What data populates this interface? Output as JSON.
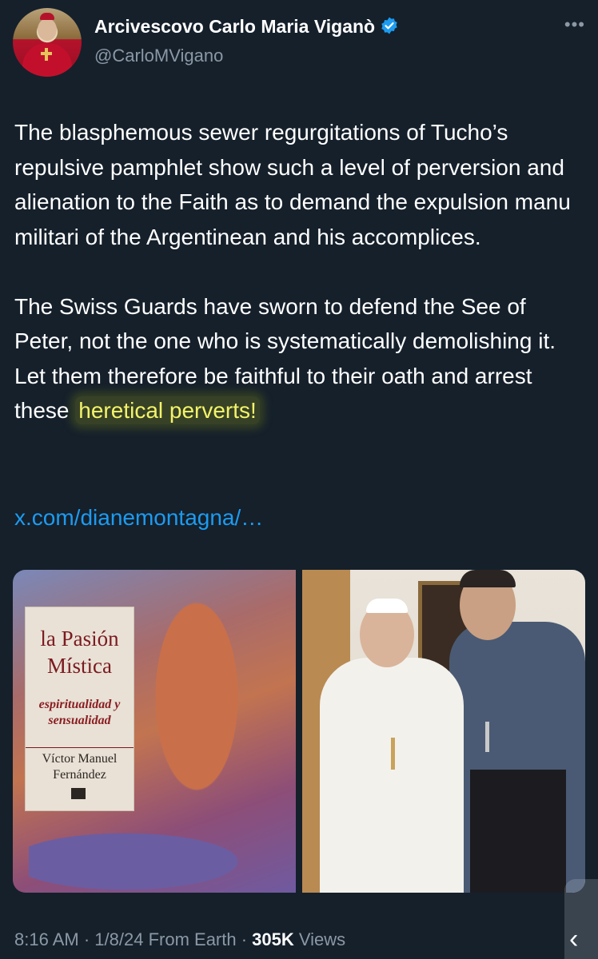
{
  "author": {
    "display_name": "Arcivescovo Carlo Maria Viganò",
    "handle": "@CarloMVigano",
    "verified": true,
    "more_icon": "more-horizontal-icon"
  },
  "tweet": {
    "paragraph1": "The blasphemous sewer regurgitations of Tucho’s repulsive pamphlet show such a level of perversion and alienation to the Faith as to demand the expulsion manu militari of the Argentinean and his accomplices.",
    "paragraph2_before": "The Swiss Guards have sworn to defend the See of Peter, not the one who is systematically demolishing it. Let them therefore be faithful to their oath and arrest these ",
    "paragraph2_highlight": "heretical perverts!",
    "link": "x.com/dianemontagna/…",
    "highlight_color": "#f3f36a",
    "link_color": "#1d9bf0"
  },
  "media": {
    "book": {
      "title": "la Pasión Mística",
      "subtitle": "espiritualidad y sensualidad",
      "author": "Víctor Manuel Fernández"
    }
  },
  "meta": {
    "time": "8:16 AM",
    "date": "1/8/24",
    "source": "From Earth",
    "views_count": "305K",
    "views_label": "Views"
  },
  "colors": {
    "background": "#15202b",
    "secondary_text": "#8b98a5",
    "verified_badge": "#1d9bf0"
  }
}
